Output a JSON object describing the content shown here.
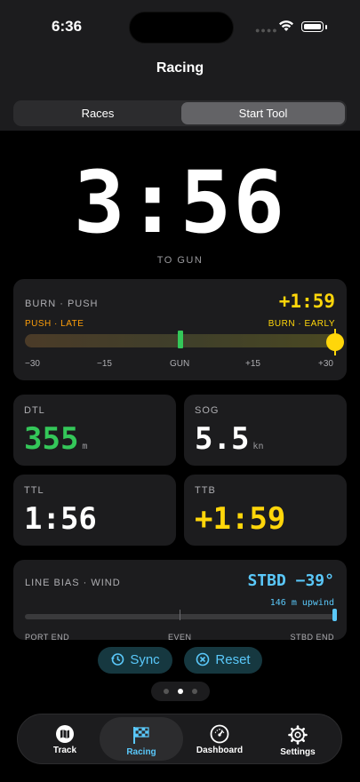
{
  "status": {
    "time": "6:36"
  },
  "nav": {
    "title": "Racing"
  },
  "segments": {
    "races": "Races",
    "start_tool": "Start Tool",
    "selected": "Start Tool"
  },
  "timer": {
    "countdown": "3:56",
    "caption": "TO GUN"
  },
  "burn": {
    "title": "BURN · PUSH",
    "value": "+1:59",
    "left_label": "PUSH · LATE",
    "right_label": "BURN · EARLY",
    "position_fraction": 1.0,
    "ticks": [
      "−30",
      "−15",
      "GUN",
      "+15",
      "+30"
    ]
  },
  "metrics": {
    "dtl": {
      "label": "DTL",
      "value": "355",
      "unit": "m",
      "color": "#34c759"
    },
    "sog": {
      "label": "SOG",
      "value": "5.5",
      "unit": "kn",
      "color": "#ffffff"
    },
    "ttl": {
      "label": "TTL",
      "value": "1:56",
      "color": "#ffffff"
    },
    "ttb": {
      "label": "TTB",
      "value": "+1:59",
      "color": "#ffd60a"
    }
  },
  "bias": {
    "title": "LINE BIAS · WIND",
    "value": "STBD −39°",
    "subtext": "146 m upwind",
    "ends": [
      "PORT END",
      "EVEN",
      "STBD END"
    ]
  },
  "actions": {
    "sync": "Sync",
    "reset": "Reset"
  },
  "pager": {
    "pages": 3,
    "current": 2
  },
  "tabs": {
    "track": "Track",
    "racing": "Racing",
    "dashboard": "Dashboard",
    "settings": "Settings",
    "selected": "Racing"
  },
  "colors": {
    "accent": "#5ac8fa",
    "green": "#34c759",
    "yellow": "#ffd60a",
    "orange": "#ff9f0a"
  }
}
